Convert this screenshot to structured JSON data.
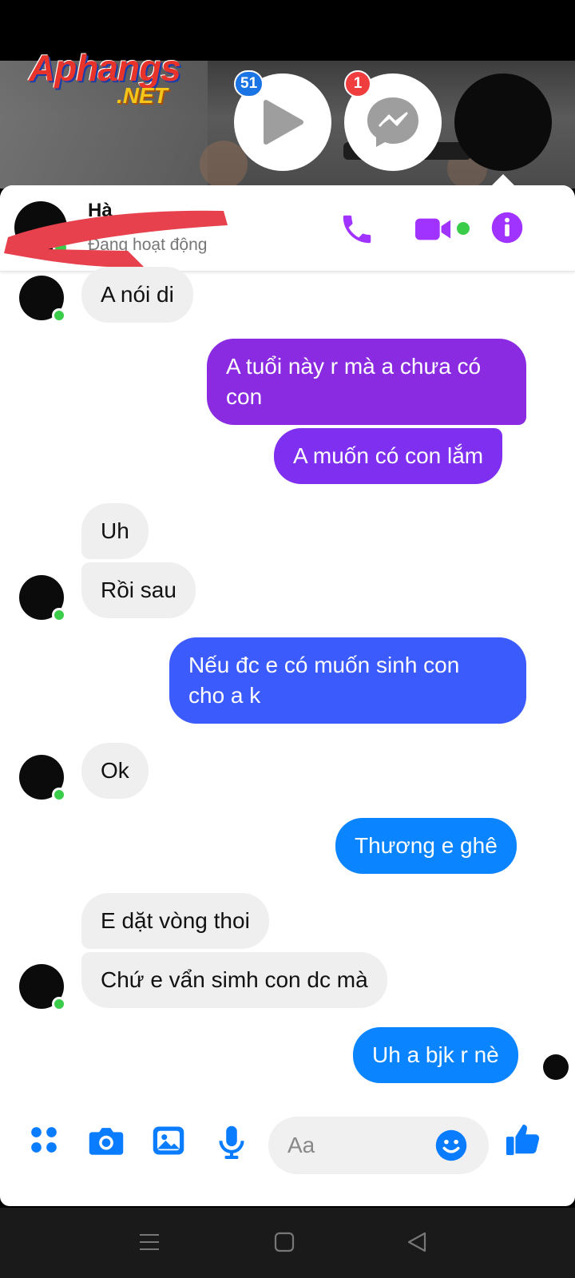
{
  "watermark": {
    "line1": "Aphangs",
    "line2": ".NET"
  },
  "chat_heads": {
    "video_badge": "51",
    "messenger_badge": "1"
  },
  "header": {
    "contact_name": "Hà",
    "status": "Đang hoạt động",
    "icons": [
      "phone-icon",
      "video-call-icon",
      "info-icon"
    ],
    "accent_color": "#a033ff"
  },
  "messages": [
    {
      "from": "them",
      "text": "A nói di"
    },
    {
      "from": "me",
      "text": "A tuổi này r mà a chưa có\ncon",
      "color": "#8a2be2"
    },
    {
      "from": "me",
      "text": "A muốn có con lắm",
      "color": "#7f2ff0"
    },
    {
      "from": "them",
      "text": "Uh"
    },
    {
      "from": "them",
      "text": "Rồi sau"
    },
    {
      "from": "me",
      "text": "Nếu đc e có muốn sinh con\ncho a k",
      "color": "#3b5bfd"
    },
    {
      "from": "them",
      "text": "Ok"
    },
    {
      "from": "me",
      "text": "Thương e ghê",
      "color": "#0a84ff"
    },
    {
      "from": "them",
      "text": "E dặt vòng thoi"
    },
    {
      "from": "them",
      "text": "Chứ e vẩn simh con dc mà"
    },
    {
      "from": "me",
      "text": "Uh a bjk r nè",
      "color": "#0a84ff"
    }
  ],
  "composer": {
    "placeholder": "Aa",
    "icons": [
      "apps-icon",
      "camera-icon",
      "gallery-icon",
      "microphone-icon",
      "emoji-icon",
      "like-icon"
    ],
    "icon_color": "#0a7cff"
  },
  "nav": {
    "icons": [
      "menu-icon",
      "home-icon",
      "back-icon"
    ]
  }
}
